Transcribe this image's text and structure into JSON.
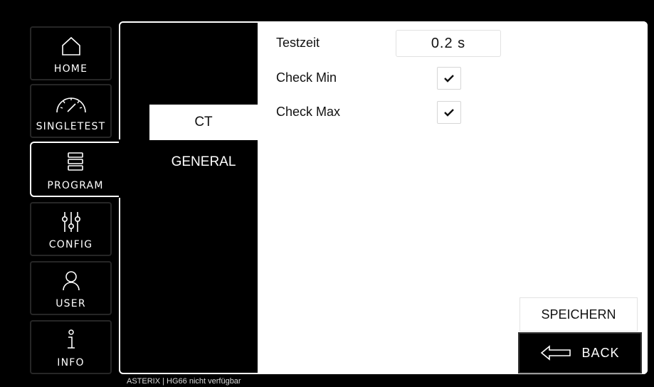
{
  "nav": {
    "items": [
      {
        "id": "home",
        "label": "HOME",
        "icon": "home-icon"
      },
      {
        "id": "singletest",
        "label": "SINGLETEST",
        "icon": "gauge-icon"
      },
      {
        "id": "program",
        "label": "PROGRAM",
        "icon": "stack-icon",
        "active": true
      },
      {
        "id": "config",
        "label": "CONFIG",
        "icon": "sliders-icon"
      },
      {
        "id": "user",
        "label": "USER",
        "icon": "user-icon"
      },
      {
        "id": "info",
        "label": "INFO",
        "icon": "info-icon"
      }
    ]
  },
  "subtabs": [
    {
      "label": "CT",
      "active": true
    },
    {
      "label": "GENERAL",
      "active": false
    }
  ],
  "settings": {
    "testzeit": {
      "label": "Testzeit",
      "value": "0.2  s"
    },
    "check_min": {
      "label": "Check Min",
      "checked": true
    },
    "check_max": {
      "label": "Check Max",
      "checked": true
    }
  },
  "actions": {
    "save_label": "SPEICHERN",
    "back_label": "BACK"
  },
  "status": {
    "text": "ASTERIX | HG66 nicht verfügbar"
  },
  "colors": {
    "background": "#000000",
    "panel": "#ffffff",
    "text_dark": "#111111",
    "text_light": "#ffffff"
  }
}
